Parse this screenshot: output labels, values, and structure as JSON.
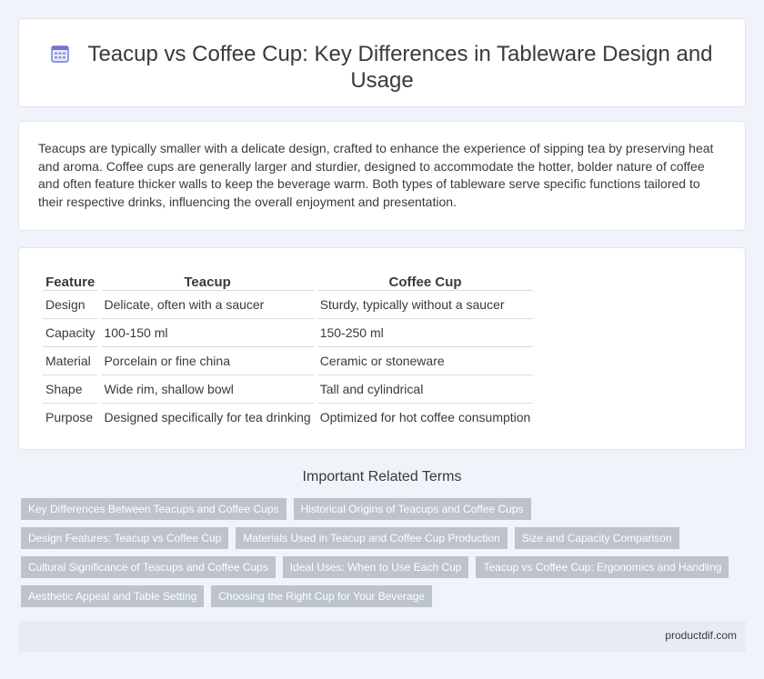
{
  "header": {
    "title": "Teacup vs Coffee Cup: Key Differences in Tableware Design and Usage",
    "icon": "calendar-grid-icon",
    "icon_color": "#6f74d6"
  },
  "intro": {
    "text": "Teacups are typically smaller with a delicate design, crafted to enhance the experience of sipping tea by preserving heat and aroma. Coffee cups are generally larger and sturdier, designed to accommodate the hotter, bolder nature of coffee and often feature thicker walls to keep the beverage warm. Both types of tableware serve specific functions tailored to their respective drinks, influencing the overall enjoyment and presentation."
  },
  "comparison": {
    "headers": [
      "Feature",
      "Teacup",
      "Coffee Cup"
    ],
    "rows": [
      [
        "Design",
        "Delicate, often with a saucer",
        "Sturdy, typically without a saucer"
      ],
      [
        "Capacity",
        "100-150 ml",
        "150-250 ml"
      ],
      [
        "Material",
        "Porcelain or fine china",
        "Ceramic or stoneware"
      ],
      [
        "Shape",
        "Wide rim, shallow bowl",
        "Tall and cylindrical"
      ],
      [
        "Purpose",
        "Designed specifically for tea drinking",
        "Optimized for hot coffee consumption"
      ]
    ]
  },
  "related": {
    "title": "Important Related Terms",
    "tags": [
      "Key Differences Between Teacups and Coffee Cups",
      "Historical Origins of Teacups and Coffee Cups",
      "Design Features: Teacup vs Coffee Cup",
      "Materials Used in Teacup and Coffee Cup Production",
      "Size and Capacity Comparison",
      "Cultural Significance of Teacups and Coffee Cups",
      "Ideal Uses: When to Use Each Cup",
      "Teacup vs Coffee Cup: Ergonomics and Handling",
      "Aesthetic Appeal and Table Setting",
      "Choosing the Right Cup for Your Beverage"
    ]
  },
  "footer": {
    "site": "productdif.com"
  }
}
